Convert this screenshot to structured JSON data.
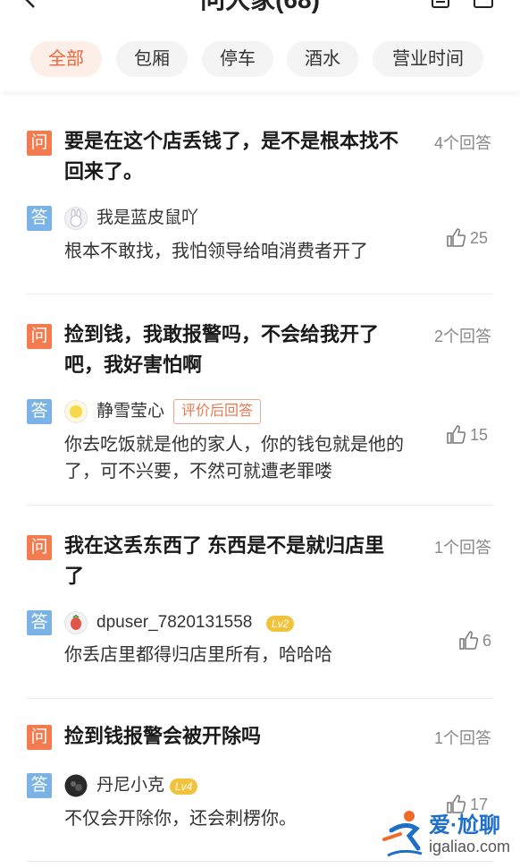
{
  "header": {
    "title": "问大家(68)",
    "back_icon": "chevron-left-icon",
    "icons": [
      "clipboard-icon",
      "share-icon"
    ]
  },
  "filters": [
    "全部",
    "包厢",
    "停车",
    "酒水",
    "营业时间"
  ],
  "active_filter": "全部",
  "badges": {
    "question": "问",
    "answer": "答"
  },
  "qa": [
    {
      "question": "要是在这个店丢钱了，是不是根本找不回来了。",
      "answer_count": "4个回答",
      "user": "我是蓝皮鼠吖",
      "answer": "根本不敢找，我怕领导给咱消费者开了",
      "likes": "25"
    },
    {
      "question": "捡到钱，我敢报警吗，不会给我开了吧，我好害怕啊",
      "answer_count": "2个回答",
      "user": "静雪莹心",
      "tag": "评价后回答",
      "answer": "你去吃饭就是他的家人，你的钱包就是他的了，可不兴要，不然可就遭老罪喽",
      "likes": "15"
    },
    {
      "question": "我在这丢东西了 东西是不是就归店里了",
      "answer_count": "1个回答",
      "user": "dpuser_7820131558",
      "level": "Lv2",
      "answer": "你丢店里都得归店里所有，哈哈哈",
      "likes": "6"
    },
    {
      "question": "捡到钱报警会被开除吗",
      "answer_count": "1个回答",
      "user": "丹尼小克",
      "level": "Lv4",
      "answer": "不仅会开除你，还会刺楞你。",
      "likes": "17"
    }
  ],
  "watermark": {
    "text": "爱·尬聊",
    "url": "igaliao.com"
  },
  "colors": {
    "accent": "#f0643c",
    "question_badge": "#f27c50",
    "answer_badge": "#7cb3e6",
    "level_badge": "#f2c23a"
  }
}
